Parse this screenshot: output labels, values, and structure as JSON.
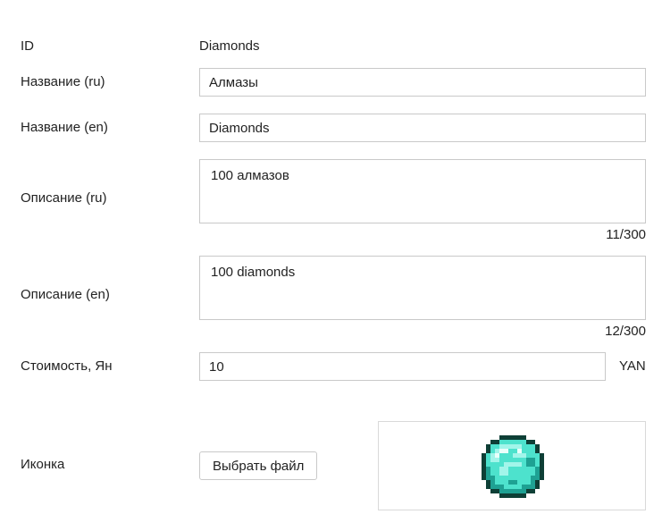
{
  "form": {
    "id": {
      "label": "ID",
      "value": "Diamonds"
    },
    "name_ru": {
      "label": "Название (ru)",
      "value": "Алмазы"
    },
    "name_en": {
      "label": "Название (en)",
      "value": "Diamonds"
    },
    "desc_ru": {
      "label": "Описание (ru)",
      "value": "100 алмазов",
      "counter": "11/300"
    },
    "desc_en": {
      "label": "Описание (en)",
      "value": "100 diamonds",
      "counter": "12/300"
    },
    "price": {
      "label": "Стоимость, Ян",
      "value": "10",
      "currency": "YAN"
    },
    "icon": {
      "label": "Иконка",
      "button_label": "Выбрать файл",
      "preview_icon": "diamond-pixel-icon"
    }
  },
  "colors": {
    "border": "#c9c9c9",
    "diamond_outline": "#0e3f36",
    "diamond_dark": "#1ea193",
    "diamond_mid": "#4de2cd",
    "diamond_light": "#a2f5ea",
    "diamond_white": "#e9fffb"
  }
}
